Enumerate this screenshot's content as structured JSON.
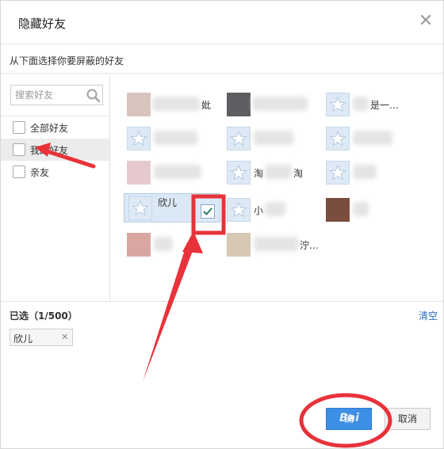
{
  "dialog": {
    "title": "隐藏好友",
    "close_icon": "close-icon",
    "subtitle": "从下面选择你要屏蔽的好友"
  },
  "search": {
    "placeholder": "搜索好友",
    "icon": "search-icon"
  },
  "groups": [
    {
      "label": "全部好友",
      "checked": false,
      "selected": false
    },
    {
      "label": "我的好友",
      "checked": false,
      "selected": true
    },
    {
      "label": "亲友",
      "checked": false,
      "selected": false
    }
  ],
  "friends": [
    {
      "name": "",
      "name_suffix": "妣",
      "avatar": "photo"
    },
    {
      "name": "",
      "avatar": "photo"
    },
    {
      "name": "是一…",
      "avatar": "star"
    },
    {
      "name": "",
      "avatar": "star"
    },
    {
      "name": "",
      "avatar": "star"
    },
    {
      "name": "",
      "avatar": "star"
    },
    {
      "name": "",
      "avatar": "photo"
    },
    {
      "name": "淘",
      "name_suffix": "淘",
      "avatar": "star"
    },
    {
      "name": "",
      "avatar": "star"
    },
    {
      "name": "欣儿",
      "avatar": "star",
      "selected": true
    },
    {
      "name": "小",
      "avatar": "star"
    },
    {
      "name": "",
      "avatar": "photo"
    },
    {
      "name": "",
      "avatar": "photo"
    },
    {
      "name": "",
      "name_suffix": "泞…",
      "avatar": "photo"
    }
  ],
  "chosen": {
    "title": "已选（1/500）",
    "clear_label": "清空",
    "tags": [
      {
        "label": "欣儿"
      }
    ]
  },
  "buttons": {
    "ok_label": "确",
    "cancel_label": "取消"
  },
  "watermark": "Bai",
  "colors": {
    "accent": "#3d8ee6",
    "annotation": "#e8323a",
    "link": "#2a6cc0"
  }
}
